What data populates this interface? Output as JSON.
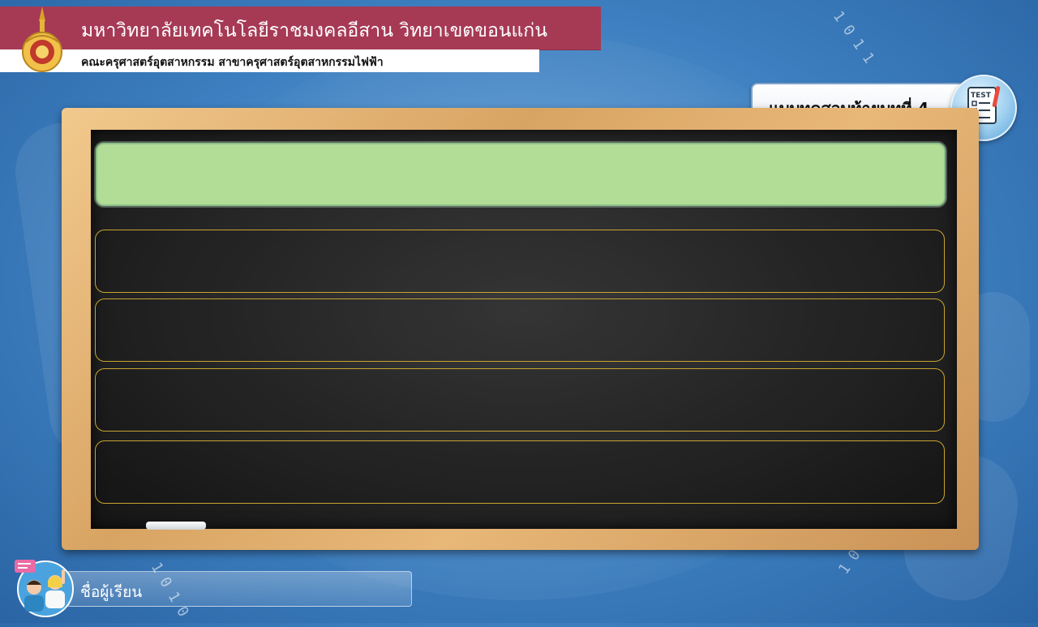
{
  "header": {
    "title": "มหาวิทยาลัยเทคโนโลยีราชมงคลอีสาน วิทยาเขตขอนแก่น",
    "subtitle": "คณะครุศาสตร์อุตสาหกรรม สาขาครุศาสตร์อุตสาหกรรมไฟฟ้า"
  },
  "quiz": {
    "title": "แบบทดสอบท้ายบทที่ 4",
    "test_icon_text": "TEST",
    "question": "",
    "choices": [
      "",
      "",
      "",
      ""
    ]
  },
  "student": {
    "name_label": "ชื่อผู้เรียน",
    "name_value": ""
  },
  "colors": {
    "header_bar": "#a63a55",
    "question_box": "#b2dd97",
    "choice_border": "#c8a431",
    "board": "#262626",
    "frame": "#d8a463"
  }
}
